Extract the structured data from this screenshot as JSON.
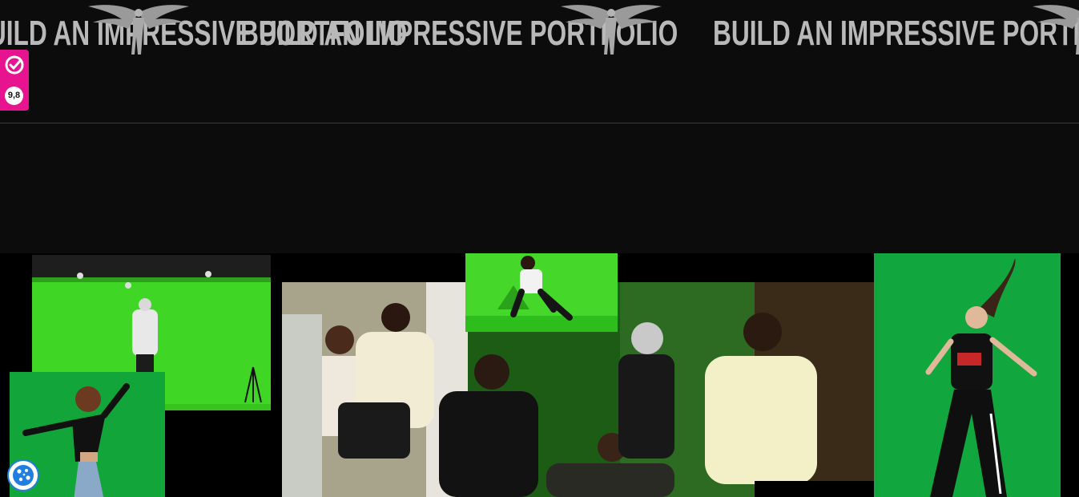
{
  "marquee": {
    "text": "BUILD AN IMPRESSIVE PORTFOLIO",
    "logo_icon": "winged-figure-logo"
  },
  "side_widget": {
    "icon": "review-check-icon",
    "rating": "9,8",
    "color": "#e8138f"
  },
  "gallery": {
    "photos": [
      {
        "name": "photo-greenscreen-studio",
        "icon": "studio-photo"
      },
      {
        "name": "photo-dancer-greenscreen",
        "icon": "dancer-photo"
      },
      {
        "name": "photo-crew-group",
        "icon": "group-photo"
      },
      {
        "name": "photo-greenscreen-crouch",
        "icon": "crouch-photo"
      },
      {
        "name": "photo-dancer-hair-flip",
        "icon": "dancer-photo"
      }
    ]
  },
  "cookie_button": {
    "icon": "cookie-icon",
    "color": "#1f7ee0"
  }
}
